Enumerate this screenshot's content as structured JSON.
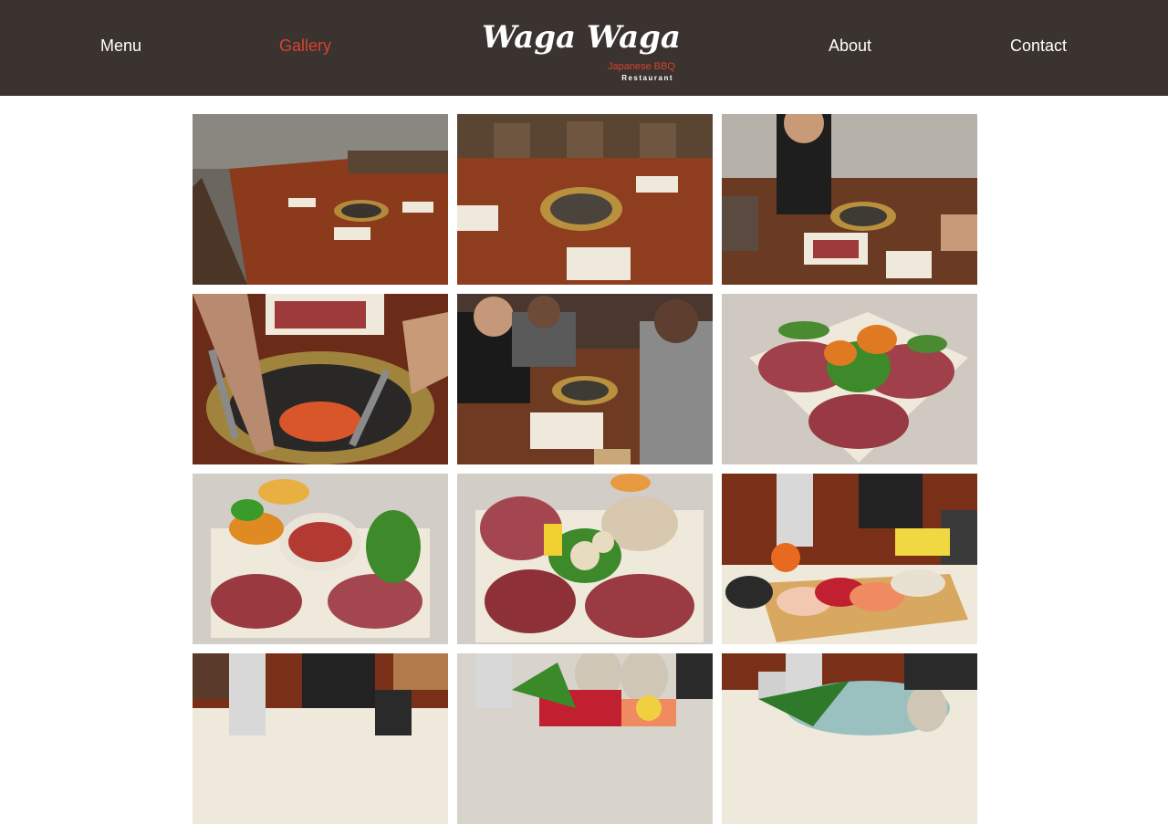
{
  "nav": {
    "menu": "Menu",
    "gallery": "Gallery",
    "about": "About",
    "contact": "Contact",
    "active": "gallery"
  },
  "logo": {
    "wordmark": "Waga Waga",
    "subtitle": "Japanese BBQ",
    "tagline": "Restaurant"
  },
  "colors": {
    "header_bg": "#3a3330",
    "accent": "#d9412f",
    "nav_text": "#ffffff"
  },
  "gallery": {
    "photos": [
      {
        "subject": "empty dining table with grill"
      },
      {
        "subject": "table grill close-up"
      },
      {
        "subject": "diners grilling at table"
      },
      {
        "subject": "tongs over charcoal grill"
      },
      {
        "subject": "guests dining at table"
      },
      {
        "subject": "beef platter with vegetables"
      },
      {
        "subject": "mixed meat platter"
      },
      {
        "subject": "seafood and beef platter"
      },
      {
        "subject": "sushi set with sake"
      },
      {
        "subject": "sake and tea set"
      },
      {
        "subject": "sashimi and oysters"
      },
      {
        "subject": "oysters and sake"
      }
    ]
  }
}
